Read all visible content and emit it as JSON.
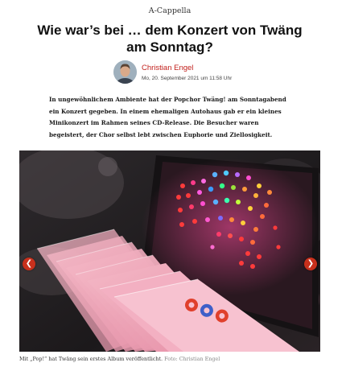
{
  "article": {
    "kicker": "A-Cappella",
    "headline": "Wie war’s bei … dem Konzert von Twäng am Sonntag?",
    "author": {
      "name": "Christian Engel",
      "date": "Mo, 20. September 2021 um 11:58 Uhr"
    },
    "lead": "In ungewöhnlichem Ambiente hat der Popchor Twäng! am Sonntagabend ein Konzert gegeben. In einem ehemaligen Autohaus gab er ein kleines Minikonzert im Rahmen seines CD-Release. Die Besucher waren begeistert, der Chor selbst lebt zwischen Euphorie und Ziellosigkeit."
  },
  "gallery": {
    "prev_icon": "chevron-left-icon",
    "next_icon": "chevron-right-icon",
    "prev_glyph": "❮",
    "next_glyph": "❯",
    "accent_color": "#c8301c",
    "caption": "Mit „Pop!“ hat Twäng sein erstes Album veröffentlicht.",
    "credit": "Foto: Christian Engel"
  },
  "colors": {
    "author_link": "#c2211c",
    "nav_button": "#c8301c"
  }
}
